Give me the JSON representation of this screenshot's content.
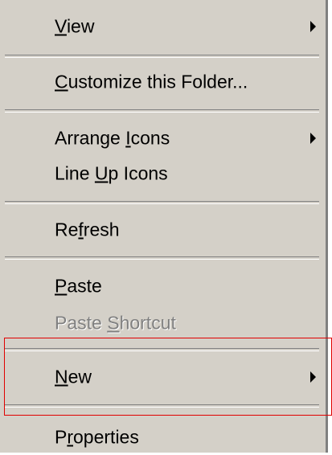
{
  "menu": {
    "items": [
      {
        "label": "View",
        "accel": "V",
        "submenu": true,
        "enabled": true
      },
      {
        "label": "Customize this Folder...",
        "accel": "C",
        "submenu": false,
        "enabled": true
      },
      {
        "label": "Arrange Icons",
        "accel": "I",
        "submenu": true,
        "enabled": true
      },
      {
        "label": "Line Up Icons",
        "accel": "U",
        "submenu": false,
        "enabled": true
      },
      {
        "label": "Refresh",
        "accel": "f",
        "submenu": false,
        "enabled": true
      },
      {
        "label": "Paste",
        "accel": "P",
        "submenu": false,
        "enabled": true
      },
      {
        "label": "Paste Shortcut",
        "accel": "S",
        "submenu": false,
        "enabled": false
      },
      {
        "label": "New",
        "accel": "N",
        "submenu": true,
        "enabled": true,
        "highlighted": true
      },
      {
        "label": "Properties",
        "accel": "r",
        "submenu": false,
        "enabled": true
      }
    ]
  },
  "colors": {
    "menu_bg": "#d4d0c8",
    "text": "#000000",
    "disabled_text": "#808080",
    "highlight_border": "#e00000"
  }
}
